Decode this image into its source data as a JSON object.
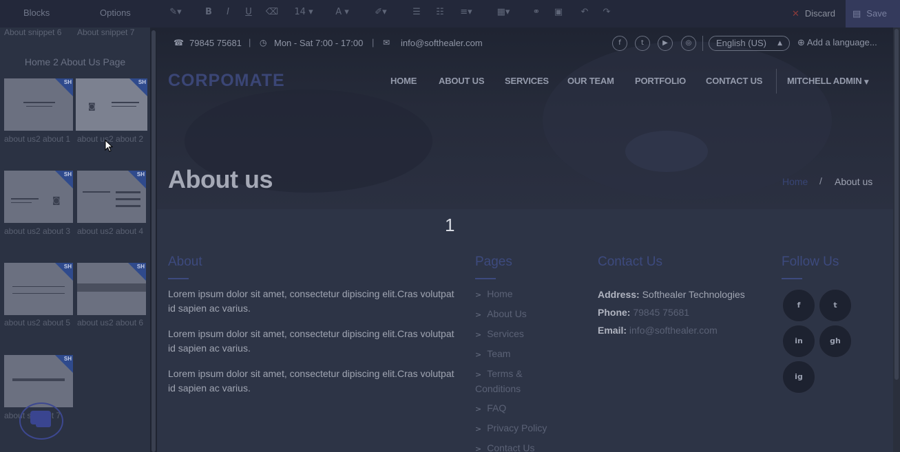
{
  "toolbar": {
    "tab_blocks": "Blocks",
    "tab_options": "Options",
    "font_size": "14",
    "discard_label": "Discard",
    "save_label": "Save"
  },
  "panel": {
    "top_captions": [
      "About snippet 6",
      "About snippet 7"
    ],
    "group_title": "Home 2 About Us Page",
    "snippets": [
      {
        "label": "about us2 about 1"
      },
      {
        "label": "about us2 about 2"
      },
      {
        "label": "about us2 about 3"
      },
      {
        "label": "about us2 about 4"
      },
      {
        "label": "about us2 about 5"
      },
      {
        "label": "about us2 about 6"
      },
      {
        "label": "about snippet 7"
      }
    ],
    "badge_text": "SH"
  },
  "site": {
    "phone": "79845 75681",
    "hours": "Mon - Sat 7:00 - 17:00",
    "email": "info@softhealer.com",
    "language": "English (US)",
    "add_language": "Add a language...",
    "logo": "CORPOMATE",
    "nav": [
      "HOME",
      "ABOUT US",
      "SERVICES",
      "OUR TEAM",
      "PORTFOLIO",
      "CONTACT US"
    ],
    "user_menu": "MITCHELL ADMIN",
    "hero_title": "About us",
    "breadcrumb_home": "Home",
    "breadcrumb_sep": "/",
    "breadcrumb_current": "About us",
    "page_indicator": "1"
  },
  "footer": {
    "about_title": "About",
    "about_paragraphs": [
      "Lorem ipsum dolor sit amet, consectetur dipiscing elit.Cras volutpat id sapien ac varius.",
      "Lorem ipsum dolor sit amet, consectetur dipiscing elit.Cras volutpat id sapien ac varius.",
      "Lorem ipsum dolor sit amet, consectetur dipiscing elit.Cras volutpat id sapien ac varius."
    ],
    "pages_title": "Pages",
    "pages": [
      "Home",
      "About Us",
      "Services",
      "Team",
      "Terms & Conditions",
      "FAQ",
      "Privacy Policy",
      "Contact Us"
    ],
    "contact_title": "Contact Us",
    "address_label": "Address:",
    "address_value": "Softhealer Technologies",
    "phone_label": "Phone:",
    "phone_value": "79845 75681",
    "email_label": "Email:",
    "email_value": "info@softhealer.com",
    "follow_title": "Follow Us",
    "social": [
      "f",
      "t",
      "in",
      "gh",
      "ig"
    ]
  }
}
